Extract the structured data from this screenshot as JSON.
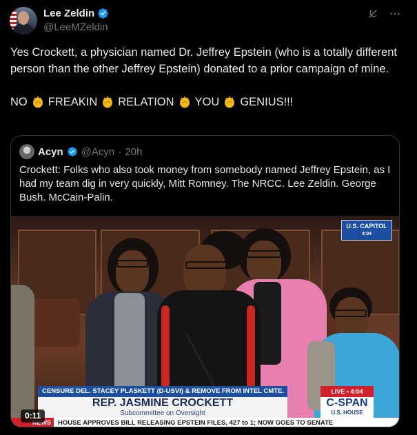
{
  "author": {
    "name": "Lee Zeldin",
    "handle": "@LeeMZeldin"
  },
  "tweet": {
    "line1": "Yes Crockett, a physician named Dr. Jeffrey Epstein (who is a totally different person than the other Jeffrey Epstein) donated to a prior campaign of mine.",
    "words": [
      "NO",
      "FREAKIN",
      "RELATION",
      "YOU",
      "GENIUS!!!"
    ]
  },
  "quoted": {
    "name": "Acyn",
    "handle": "@Acyn",
    "time": "20h",
    "text": "Crockett: Folks who also took money from somebody named Jeffrey Epstein, as I had my team dig in very quickly, Mitt Romney. The NRCC. Lee Zeldin. George Bush. McCain-Palin."
  },
  "video": {
    "network_bug": "U.S. CAPITOL",
    "network_time": "4:04",
    "chyron_top": "CENSURE DEL. STACEY PLASKETT (D-USVI) & REMOVE FROM INTEL CMTE.",
    "chyron_name": "REP. JASMINE CROCKETT",
    "chyron_sub": "Subcommittee on Oversight",
    "live_label": "LIVE • 4:04",
    "cspan_logo": "C-SPAN",
    "cspan_sub": "U.S. HOUSE",
    "ticker_label": "NEWS",
    "ticker_text": "HOUSE APPROVES BILL RELEASING EPSTEIN FILES, 427 to 1; NOW GOES TO SENATE",
    "timestamp": "0:11"
  },
  "icons": [
    "verified-badge-icon",
    "grok-icon",
    "more-icon",
    "clap-emoji-icon"
  ],
  "colors": {
    "background": "#000000",
    "text": "#e7e9ea",
    "secondary": "#71767b",
    "verified": "#1d9bf0",
    "border": "#2f3336"
  }
}
